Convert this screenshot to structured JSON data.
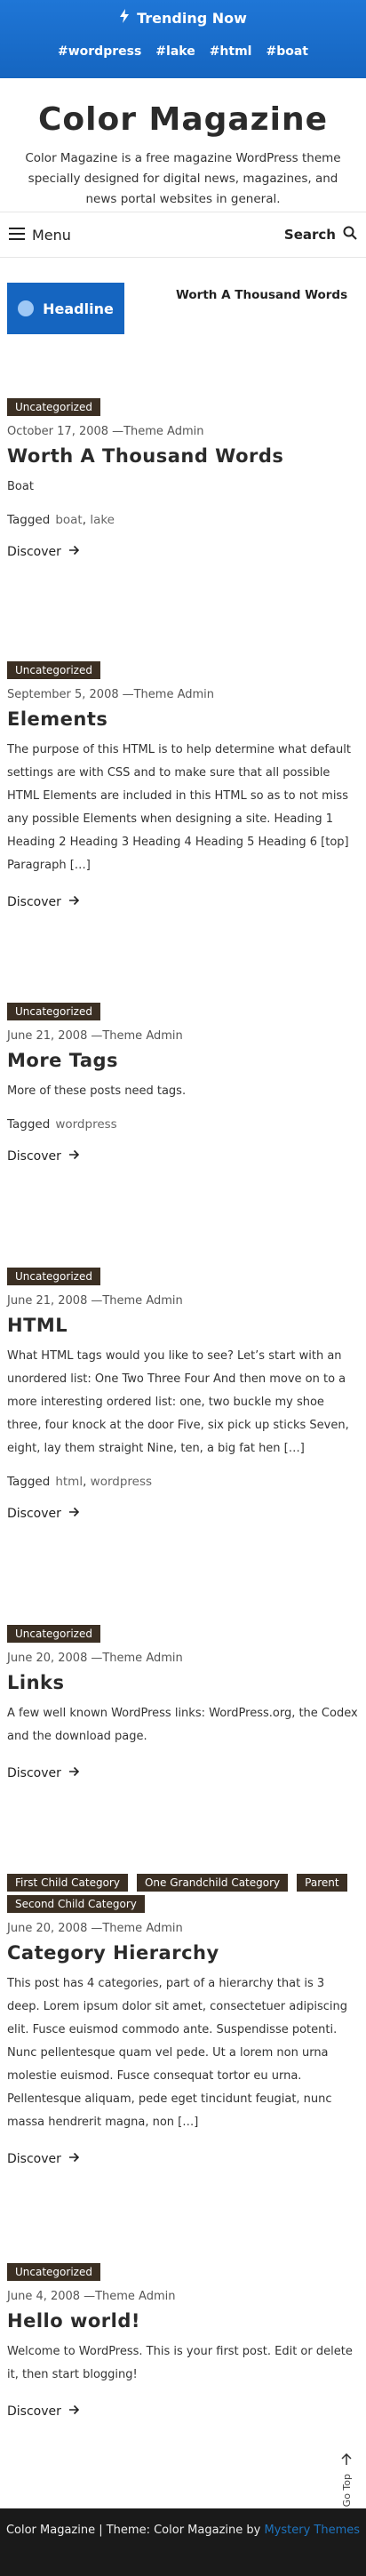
{
  "trending": {
    "title": "Trending Now",
    "tags": [
      "#wordpress",
      "#lake",
      "#html",
      "#boat"
    ]
  },
  "site": {
    "title": "Color Magazine",
    "description": "Color Magazine is a free magazine WordPress theme specially designed for digital news, magazines, and news portal websites in general."
  },
  "menubar": {
    "menu_label": "Menu",
    "search_label": "Search"
  },
  "headline": {
    "badge_label": "Headline",
    "text": "Worth A Thousand Words"
  },
  "labels": {
    "tagged": "Tagged",
    "discover": "Discover",
    "by": "—Theme Admin"
  },
  "posts": [
    {
      "categories": [
        "Uncategorized"
      ],
      "date": "October 17, 2008",
      "title": "Worth A Thousand Words",
      "excerpt": "Boat",
      "tags": [
        "boat",
        "lake"
      ]
    },
    {
      "categories": [
        "Uncategorized"
      ],
      "date": "September 5, 2008",
      "title": "Elements",
      "excerpt": "The purpose of this HTML is to help determine what default settings are with CSS and to make sure that all possible HTML Elements are included in this HTML so as to not miss any possible Elements when designing a site. Heading 1 Heading 2 Heading 3 Heading 4 Heading 5 Heading 6 [top] Paragraph […]",
      "tags": []
    },
    {
      "categories": [
        "Uncategorized"
      ],
      "date": "June 21, 2008",
      "title": "More Tags",
      "excerpt": "More of these posts need tags.",
      "tags": [
        "wordpress"
      ]
    },
    {
      "categories": [
        "Uncategorized"
      ],
      "date": "June 21, 2008",
      "title": "HTML",
      "excerpt": "What HTML tags would you like to see? Let’s start with an unordered list: One Two Three Four And then move on to a more interesting ordered list: one, two buckle my shoe three, four knock at the door Five, six pick up sticks Seven, eight, lay them straight Nine, ten, a big fat hen […]",
      "tags": [
        "html",
        "wordpress"
      ]
    },
    {
      "categories": [
        "Uncategorized"
      ],
      "date": "June 20, 2008",
      "title": "Links",
      "excerpt": "A few well known WordPress links: WordPress.org, the Codex and the download page.",
      "tags": []
    },
    {
      "categories": [
        "First Child Category",
        "One Grandchild Category",
        "Parent",
        "Second Child Category"
      ],
      "date": "June 20, 2008",
      "title": "Category Hierarchy",
      "excerpt": "This post has 4 categories, part of a hierarchy that is 3 deep. Lorem ipsum dolor sit amet, consectetuer adipiscing elit. Fusce euismod commodo ante. Suspendisse potenti. Nunc pellentesque quam vel pede. Ut a lorem non urna molestie euismod. Fusce consequat tortor eu urna. Pellentesque aliquam, pede eget tincidunt feugiat, nunc massa hendrerit magna, non […]",
      "tags": []
    },
    {
      "categories": [
        "Uncategorized"
      ],
      "date": "June 4, 2008",
      "title": "Hello world!",
      "excerpt": "Welcome to WordPress. This is your first post. Edit or delete it, then start blogging!",
      "tags": []
    }
  ],
  "back_to_top": "Go Top",
  "footer": {
    "text": "Color Magazine | Theme: Color Magazine by",
    "brand": "Mystery Themes",
    "brand_color": "#1e73be"
  },
  "colors": {
    "accent": "#1565c0",
    "category_bg": "#3b2f23",
    "footer_bg": "#1a1a1a"
  }
}
